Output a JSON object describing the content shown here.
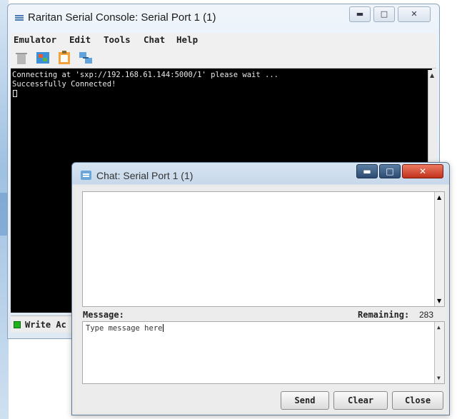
{
  "main_window": {
    "title": "Raritan Serial Console: Serial Port 1 (1)",
    "menu": [
      "Emulator",
      "Edit",
      "Tools",
      "Chat",
      "Help"
    ],
    "toolbar_icons": [
      "trash-icon",
      "connect-icon",
      "clipboard-icon",
      "network-icon"
    ],
    "terminal_lines": [
      "Connecting at 'sxp://192.168.61.144:5000/1' please wait ...",
      "Successfully Connected!"
    ],
    "status_text": "Write Ac"
  },
  "chat_window": {
    "title": "Chat: Serial Port 1 (1)",
    "message_label": "Message:",
    "remaining_label": "Remaining:",
    "remaining_value": "283",
    "message_value": "Type message here",
    "buttons": {
      "send": "Send",
      "clear": "Clear",
      "close": "Close"
    }
  },
  "colors": {
    "terminal_bg": "#000000",
    "terminal_fg": "#e8e8e8",
    "status_led": "#1db31d",
    "close_button": "#d9442f"
  }
}
